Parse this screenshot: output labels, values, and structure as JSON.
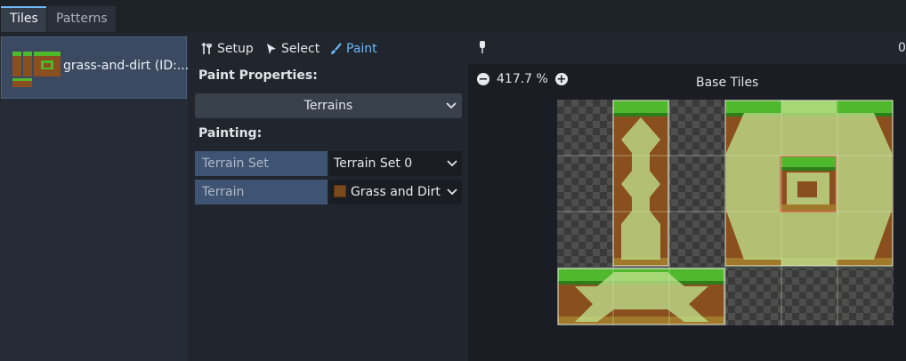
{
  "tabs": [
    {
      "label": "Tiles",
      "active": true
    },
    {
      "label": "Patterns",
      "active": false
    }
  ],
  "atlas_list": {
    "items": [
      {
        "name": "grass-and-dirt (ID:...",
        "selected": true
      }
    ]
  },
  "toolbar": {
    "setup_label": "Setup",
    "select_label": "Select",
    "paint_label": "Paint",
    "active_tool": "paint"
  },
  "paint_properties": {
    "heading": "Paint Properties:",
    "mode_value": "Terrains"
  },
  "painting": {
    "heading": "Painting:",
    "terrain_set_label": "Terrain Set",
    "terrain_set_value": "Terrain Set 0",
    "terrain_label": "Terrain",
    "terrain_value": "Grass and Dirt",
    "terrain_color": "#7a4a1c"
  },
  "viewer": {
    "zoom_label": "417.7 %",
    "title": "Base Tiles",
    "right_readout": "0"
  },
  "colors": {
    "accent": "#70bafa",
    "grass": "#4fb82c",
    "dirt": "#8a4f1e",
    "terrain_overlay": "#bfe08c"
  },
  "icons": [
    "wrench-icon",
    "cursor-icon",
    "paint-brush-icon",
    "zoom-out-icon",
    "zoom-in-icon",
    "chevron-down-icon",
    "pin-icon"
  ]
}
